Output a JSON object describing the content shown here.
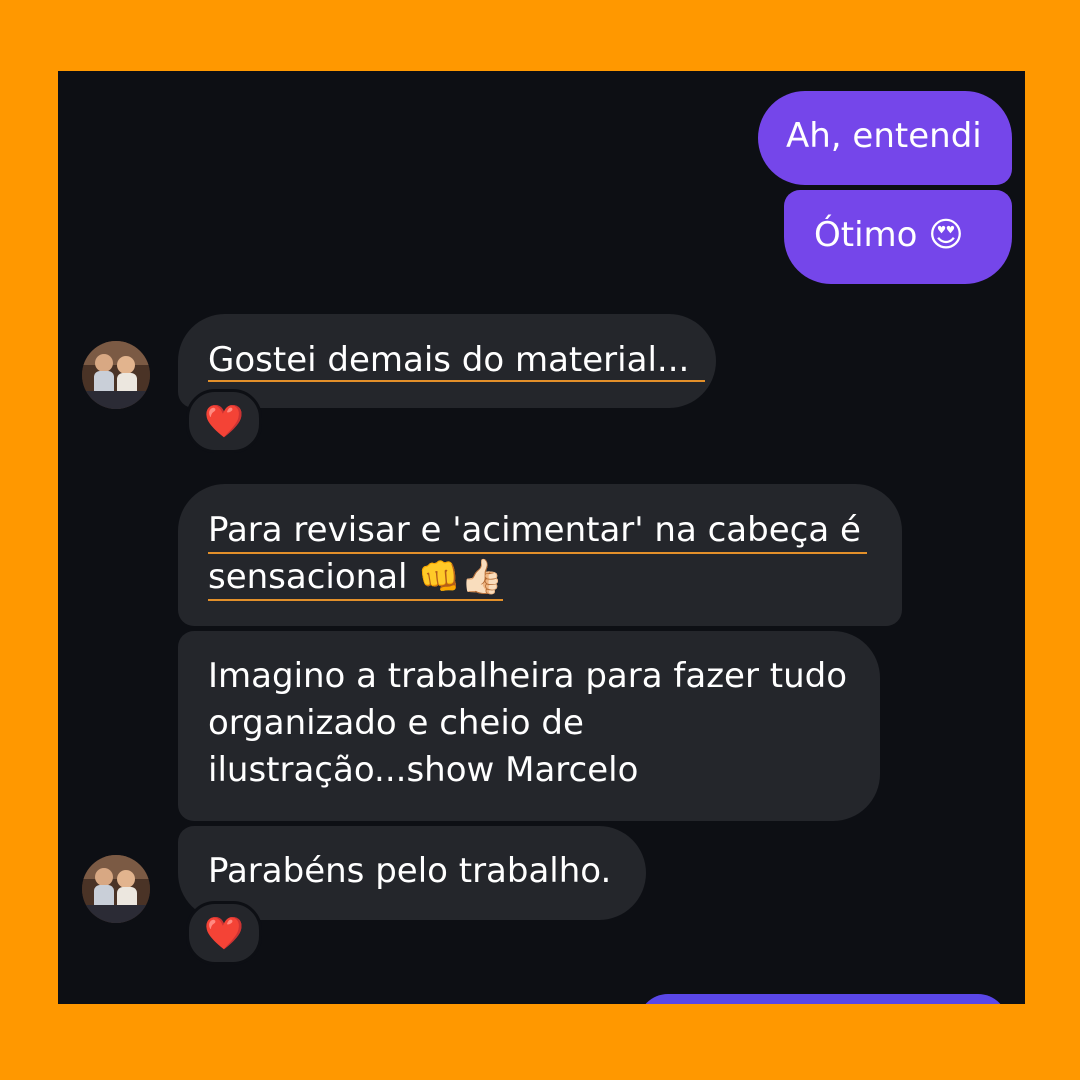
{
  "messages": {
    "m1": "Ah, entendi",
    "m2": "Ótimo 😍",
    "m3": "Gostei demais do material...",
    "m4_line1": "Para revisar e 'acimentar' na cabeça é",
    "m4_line2": "sensacional 👊👍🏻",
    "m5_line1": "Imagino a trabalheira para fazer tudo",
    "m5_line2": "organizado e cheio de",
    "m5_line3": "ilustração...show Marcelo",
    "m6": "Parabéns pelo trabalho."
  },
  "reactions": {
    "r1": "❤️",
    "r2": "❤️"
  },
  "colors": {
    "frame": "#ff9800",
    "screen_bg": "#0d0f14",
    "outgoing_bubble": "#7546ea",
    "incoming_bubble": "#24262b",
    "link_underline": "#e3902a"
  },
  "icons": {
    "avatar": "profile-photo",
    "reaction": "heart-icon"
  }
}
